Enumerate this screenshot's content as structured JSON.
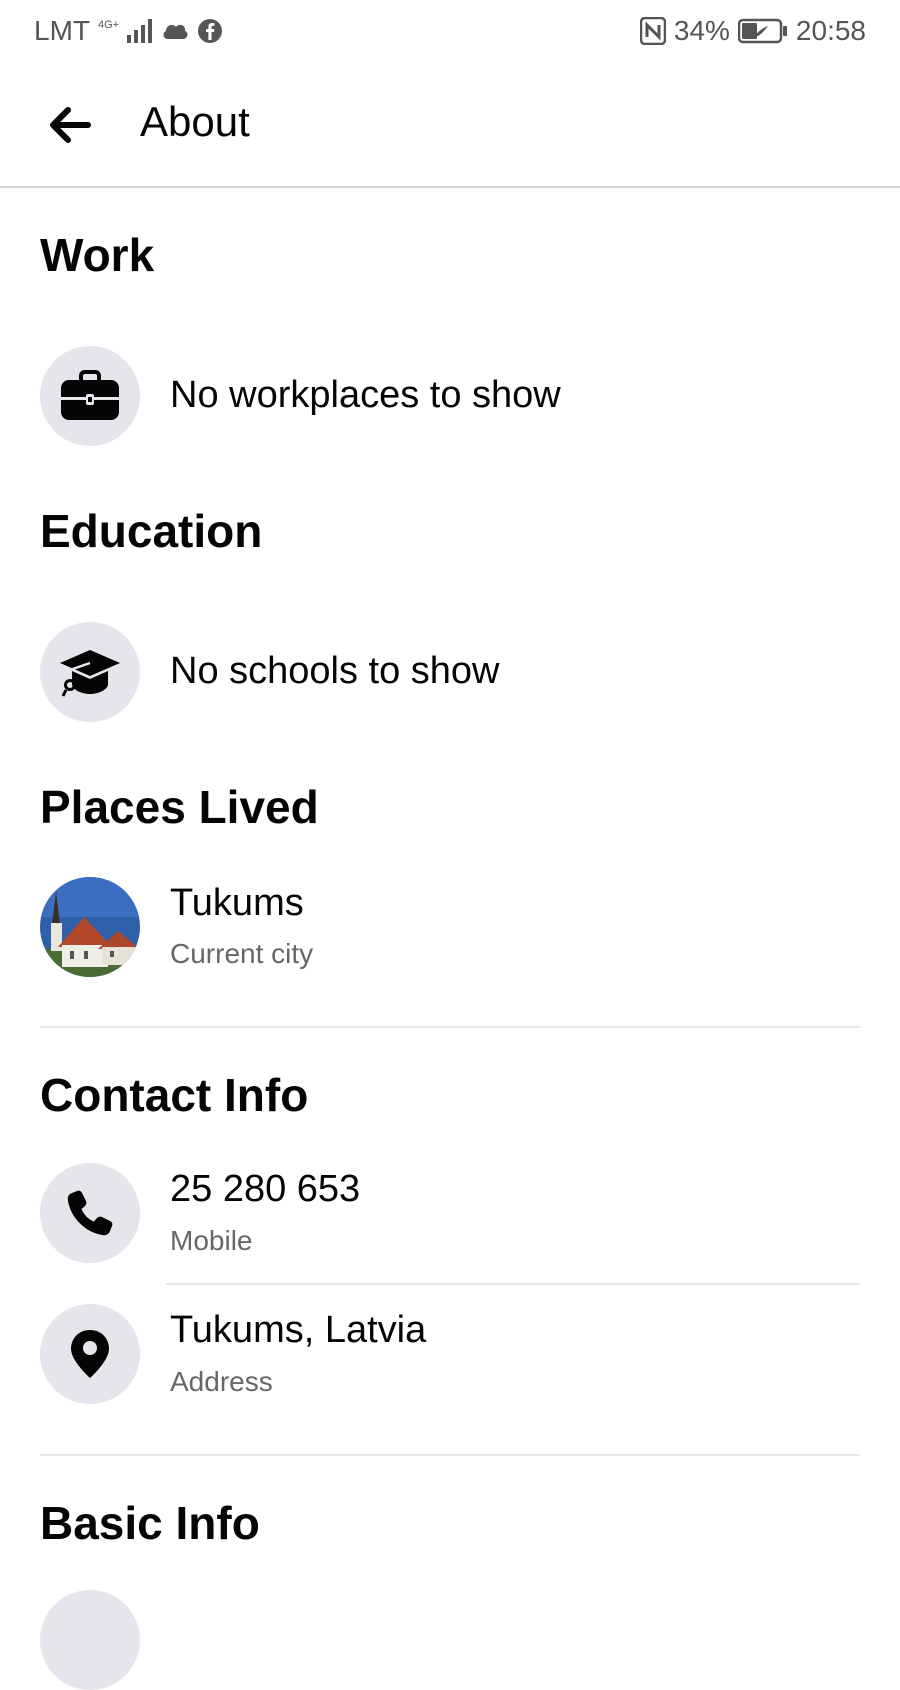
{
  "status_bar": {
    "carrier": "LMT",
    "network_type": "4G+",
    "battery_percent": "34%",
    "time": "20:58",
    "icons": [
      "signal-icon",
      "cloud-icon",
      "facebook-icon",
      "nfc-icon",
      "battery-icon"
    ]
  },
  "header": {
    "title": "About",
    "back_icon": "arrow-left-icon"
  },
  "work": {
    "title": "Work",
    "empty_text": "No workplaces to show",
    "icon": "briefcase-icon"
  },
  "education": {
    "title": "Education",
    "empty_text": "No schools to show",
    "icon": "graduation-cap-icon"
  },
  "places_lived": {
    "title": "Places Lived",
    "items": [
      {
        "name": "Tukums",
        "label": "Current city"
      }
    ]
  },
  "contact_info": {
    "title": "Contact Info",
    "items": [
      {
        "value": "25 280 653",
        "label": "Mobile",
        "icon": "phone-icon"
      },
      {
        "value": "Tukums, Latvia",
        "label": "Address",
        "icon": "map-pin-icon"
      }
    ]
  },
  "basic_info": {
    "title": "Basic Info"
  },
  "colors": {
    "icon_bg": "#e4e6eb",
    "primary_text": "#050505",
    "secondary_text": "#65676b"
  }
}
